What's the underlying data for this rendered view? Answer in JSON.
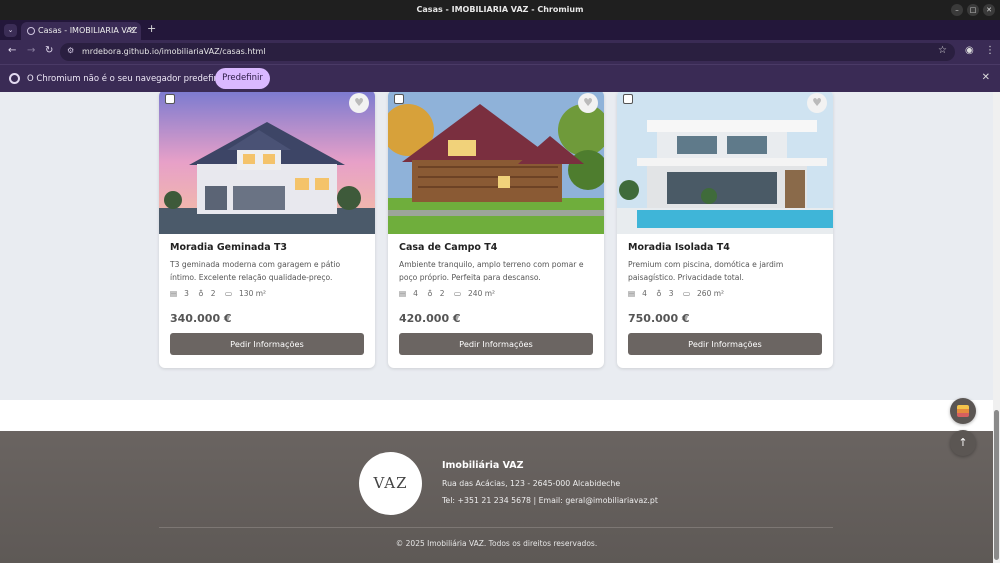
{
  "window": {
    "title": "Casas - IMOBILIARIA VAZ - Chromium"
  },
  "tabs": [
    {
      "title": "Casas - IMOBILIARIA VAZ",
      "icon": "globe-icon"
    }
  ],
  "toolbar": {
    "url": "mrdebora.github.io/imobiliariaVAZ/casas.html"
  },
  "infobar": {
    "text": "O Chromium não é o seu navegador predefinido.",
    "button": "Predefinir"
  },
  "colors": {
    "button": "#6b6562",
    "footer": "#6a6461",
    "page_bg": "#e9ecf1",
    "info_button": "#d9b8ff"
  },
  "cards": [
    {
      "title": "Moradia Geminada T3",
      "description": "T3 geminada moderna com garagem e pátio íntimo. Excelente relação qualidade-preço.",
      "bedrooms": "3",
      "bathrooms": "2",
      "area": "130 m²",
      "price": "340.000 €",
      "button": "Pedir Informações"
    },
    {
      "title": "Casa de Campo T4",
      "description": "Ambiente tranquilo, amplo terreno com pomar e poço próprio. Perfeita para descanso.",
      "bedrooms": "4",
      "bathrooms": "2",
      "area": "240 m²",
      "price": "420.000 €",
      "button": "Pedir Informações"
    },
    {
      "title": "Moradia Isolada T4",
      "description": "Premium com piscina, domótica e jardim paisagístico. Privacidade total.",
      "bedrooms": "4",
      "bathrooms": "3",
      "area": "260 m²",
      "price": "750.000 €",
      "button": "Pedir Informações"
    }
  ],
  "footer": {
    "logo_text": "VAZ",
    "company": "Imobiliária VAZ",
    "address": "Rua das Acácias, 123 - 2645-000 Alcabideche",
    "contact": "Tel: +351 21 234 5678 | Email: geral@imobiliariavaz.pt",
    "copyright": "© 2025 Imobiliária VAZ. Todos os direitos reservados."
  }
}
